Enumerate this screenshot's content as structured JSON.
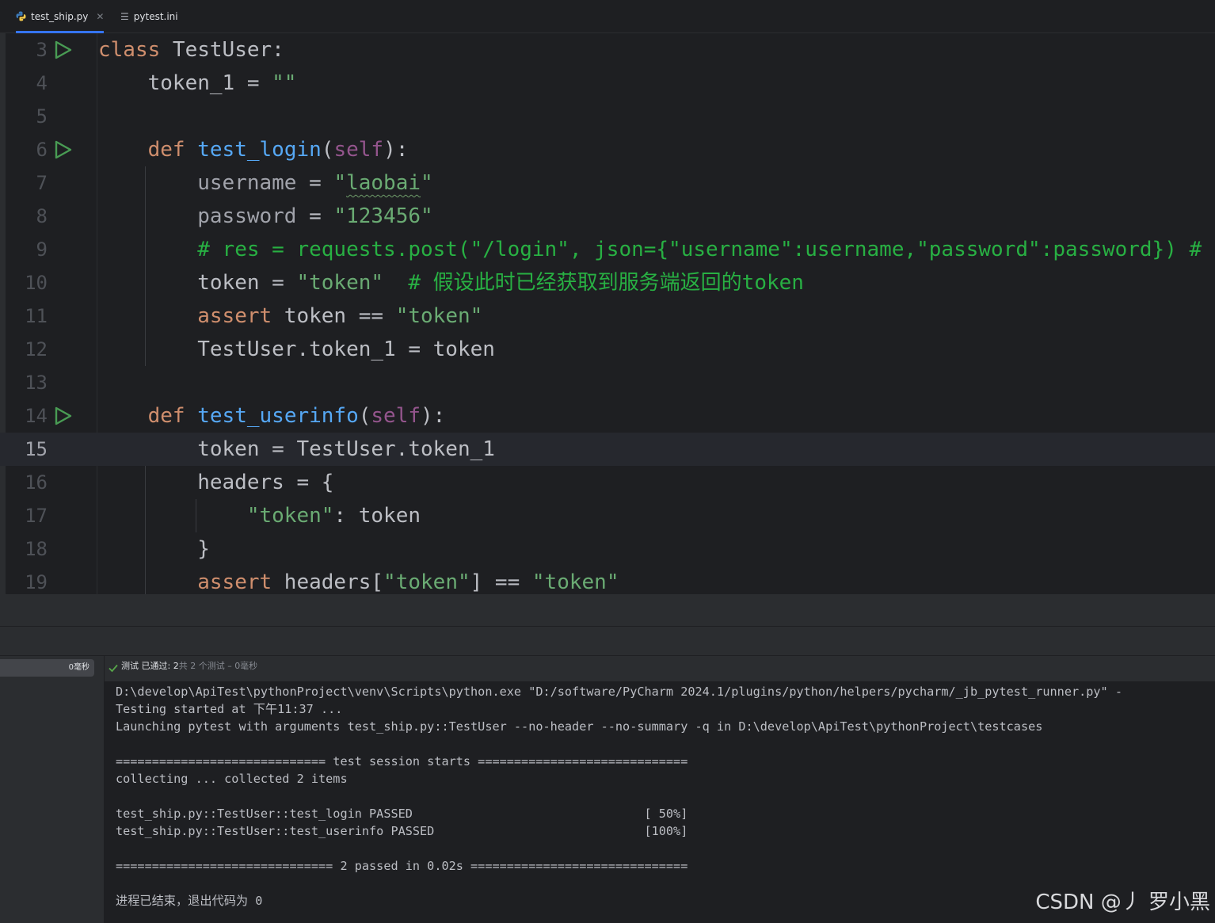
{
  "tabs": [
    {
      "label": "test_ship.py",
      "icon": "python-file-icon",
      "active": true,
      "closable": true
    },
    {
      "label": "pytest.ini",
      "icon": "ini-file-icon",
      "active": false,
      "closable": false
    }
  ],
  "editor": {
    "current_line": "15",
    "lines": [
      {
        "num": "3",
        "run": true
      },
      {
        "num": "4",
        "run": false
      },
      {
        "num": "5",
        "run": false
      },
      {
        "num": "6",
        "run": true
      },
      {
        "num": "7",
        "run": false
      },
      {
        "num": "8",
        "run": false
      },
      {
        "num": "9",
        "run": false
      },
      {
        "num": "10",
        "run": false
      },
      {
        "num": "11",
        "run": false
      },
      {
        "num": "12",
        "run": false
      },
      {
        "num": "13",
        "run": false
      },
      {
        "num": "14",
        "run": true
      },
      {
        "num": "15",
        "run": false
      },
      {
        "num": "16",
        "run": false
      },
      {
        "num": "17",
        "run": false
      },
      {
        "num": "18",
        "run": false
      },
      {
        "num": "19",
        "run": false
      }
    ],
    "code": {
      "l3": {
        "kw": "class",
        "name": " TestUser:"
      },
      "l4": {
        "text": "    token_1 = ",
        "str": "\"\""
      },
      "l6": {
        "indent": "    ",
        "kw": "def",
        "fn": " test_login",
        "p1": "(",
        "self": "self",
        "p2": "):"
      },
      "l7": {
        "indent": "        ",
        "var": "username",
        "op": " = ",
        "q1": "\"",
        "word": "laobai",
        "q2": "\""
      },
      "l8": {
        "indent": "        ",
        "var": "password",
        "op": " = ",
        "str": "\"123456\""
      },
      "l9": {
        "indent": "        ",
        "cmt": "# res = requests.post(\"/login\", json={\"username\":username,\"password\":password}) #"
      },
      "l10": {
        "indent": "        ",
        "text": "token = ",
        "str": "\"token\"",
        "cmt": "  # 假设此时已经获取到服务端返回的token"
      },
      "l11": {
        "indent": "        ",
        "kw": "assert",
        "text": " token == ",
        "str": "\"token\""
      },
      "l12": {
        "text": "        TestUser.token_1 = token"
      },
      "l14": {
        "indent": "    ",
        "kw": "def",
        "fn": " test_userinfo",
        "p1": "(",
        "self": "self",
        "p2": "):"
      },
      "l15": {
        "text": "        token = TestUser.token_1"
      },
      "l16": {
        "text": "        headers = {"
      },
      "l17": {
        "indent": "            ",
        "str": "\"token\"",
        "text": ": token"
      },
      "l18": {
        "text": "        }"
      },
      "l19": {
        "indent": "        ",
        "kw": "assert",
        "t1": " headers[",
        "str1": "\"token\"",
        "t2": "] == ",
        "str2": "\"token\""
      }
    }
  },
  "run_panel": {
    "tree_time": "0毫秒",
    "status_main": "测试 已通过: 2",
    "status_dim": "共 2 个测试 – 0毫秒",
    "console": [
      "D:\\develop\\ApiTest\\pythonProject\\venv\\Scripts\\python.exe \"D:/software/PyCharm 2024.1/plugins/python/helpers/pycharm/_jb_pytest_runner.py\" -",
      "Testing started at 下午11:37 ...",
      "Launching pytest with arguments test_ship.py::TestUser --no-header --no-summary -q in D:\\develop\\ApiTest\\pythonProject\\testcases",
      "",
      "============================= test session starts =============================",
      "collecting ... collected 2 items",
      "",
      "test_ship.py::TestUser::test_login PASSED                                [ 50%]",
      "test_ship.py::TestUser::test_userinfo PASSED                             [100%]",
      "",
      "============================== 2 passed in 0.02s ==============================",
      "",
      "进程已结束，退出代码为 0"
    ]
  },
  "watermark": "CSDN @丿 罗小黑",
  "colors": {
    "keyword": "#cf8e6d",
    "function": "#56a8f5",
    "string": "#6aab73",
    "comment": "#28b043",
    "self": "#94558d",
    "run": "#499c54",
    "accent": "#3574f0"
  }
}
